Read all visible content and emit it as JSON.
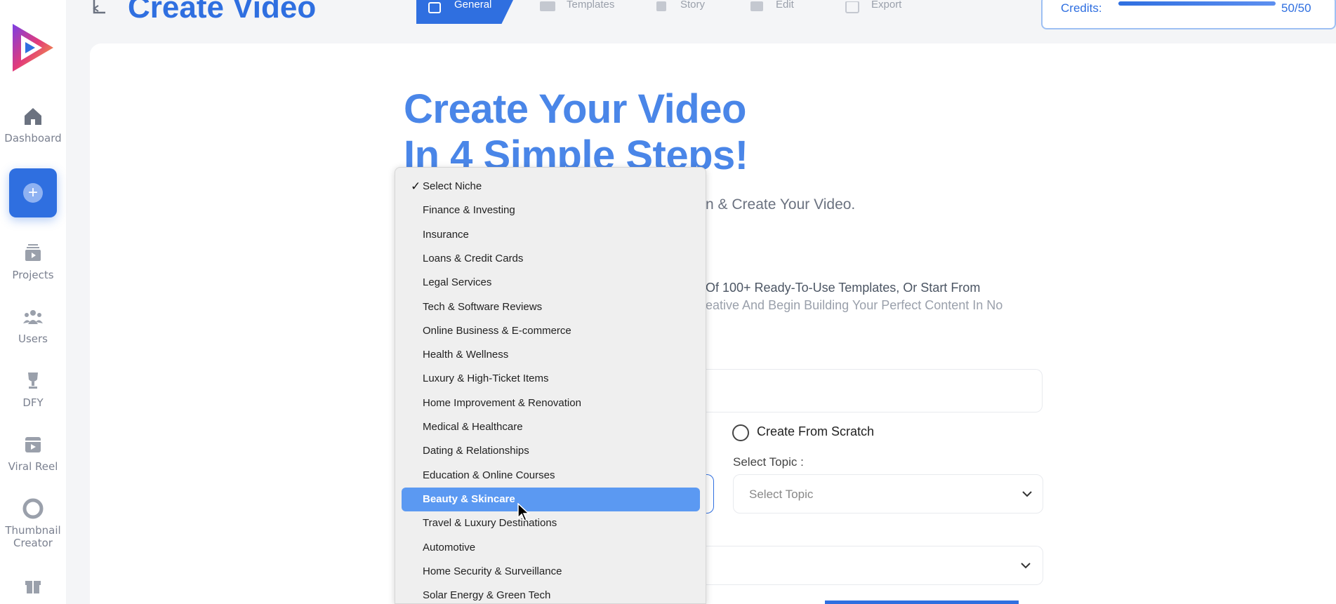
{
  "sidebar": {
    "items": [
      {
        "label": "Dashboard",
        "icon": "home-icon"
      },
      {
        "label": "",
        "icon": "plus-icon"
      },
      {
        "label": "Projects",
        "icon": "projects-icon"
      },
      {
        "label": "Users",
        "icon": "users-icon"
      },
      {
        "label": "DFY",
        "icon": "trophy-icon"
      },
      {
        "label": "Viral Reel",
        "icon": "reel-icon"
      },
      {
        "label": "Thumbnail Creator",
        "icon": "lifebuoy-icon"
      },
      {
        "label": "",
        "icon": "gift-icon"
      }
    ]
  },
  "header": {
    "title": "Create Video",
    "steps": [
      "General",
      "Templates",
      "Story",
      "Edit",
      "Export"
    ],
    "credits_label": "Credits:",
    "credits_value": "50/50",
    "credits_fraction": 1.0
  },
  "main": {
    "hero_line1": "Create Your Video",
    "hero_line2": "In 4 Simple Steps!",
    "subtitle_fragment": "n & Create Your Video.",
    "description_line1": "Of 100+ Ready-To-Use Templates, Or Start From",
    "description_line2": "eative And Begin Building Your Perfect Content In No",
    "scratch_label": "Create From Scratch",
    "topic_label": "Select Topic :",
    "topic_placeholder": "Select Topic"
  },
  "dropdown": {
    "selected": "Select Niche",
    "highlighted": "Beauty & Skincare",
    "options": [
      "Select Niche",
      "Finance & Investing",
      "Insurance",
      "Loans & Credit Cards",
      "Legal Services",
      "Tech & Software Reviews",
      "Online Business & E-commerce",
      "Health & Wellness",
      "Luxury & High-Ticket Items",
      "Home Improvement & Renovation",
      "Medical & Healthcare",
      "Dating & Relationships",
      "Education & Online Courses",
      "Beauty & Skincare",
      "Travel & Luxury Destinations",
      "Automotive",
      "Home Security & Surveillance",
      "Solar Energy & Green Tech"
    ]
  },
  "colors": {
    "accent": "#2f6fe0",
    "hero": "#4a86e8",
    "highlight": "#5b99f2"
  }
}
